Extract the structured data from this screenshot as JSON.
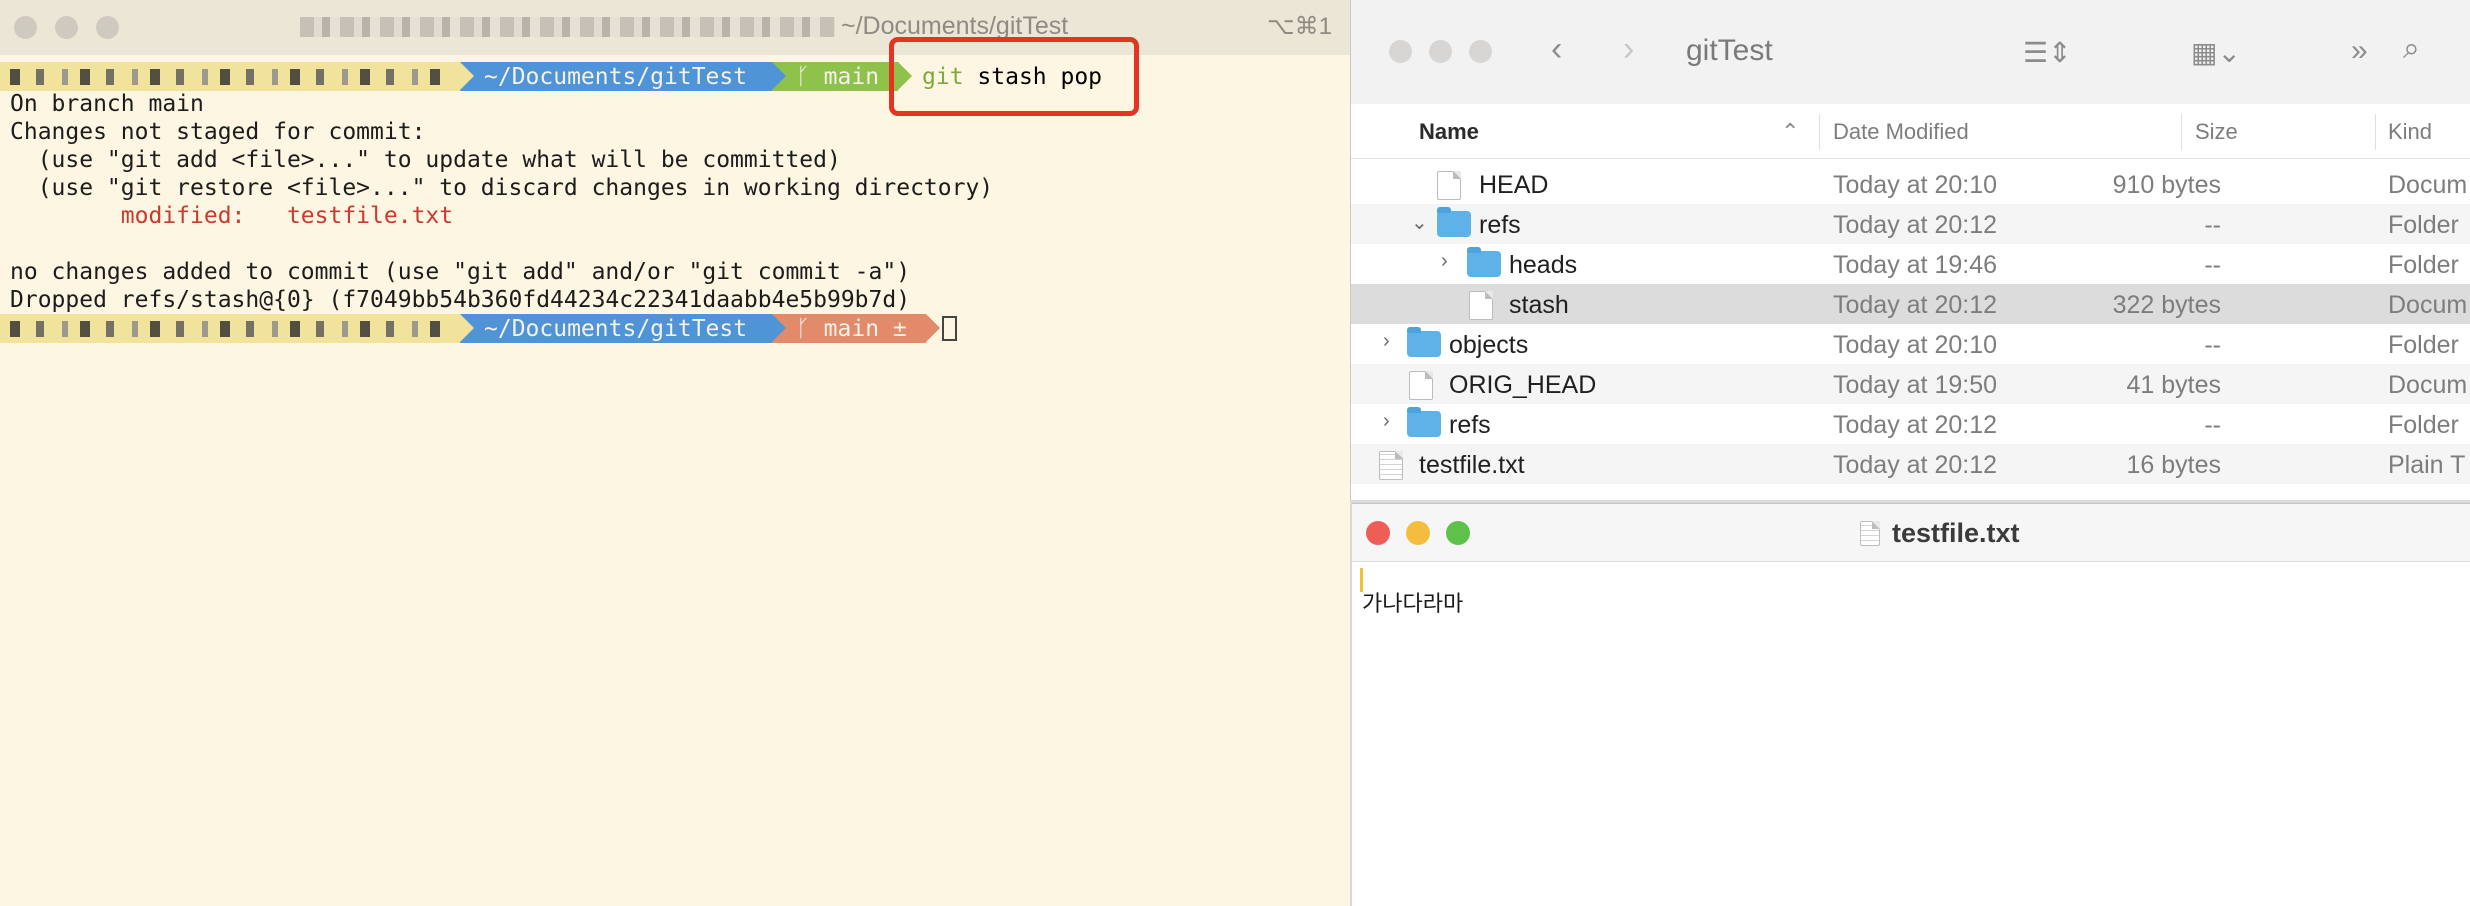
{
  "terminal": {
    "title": "~/Documents/gitTest",
    "shortcut": "⌥⌘1",
    "prompt1": {
      "dir": "~/Documents/gitTest",
      "branch": "main",
      "command_git": "git",
      "command_rest": "stash pop"
    },
    "lines": [
      "On branch main",
      "Changes not staged for commit:",
      "  (use \"git add <file>...\" to update what will be committed)",
      "  (use \"git restore <file>...\" to discard changes in working directory)",
      "        modified:   testfile.txt",
      "",
      "no changes added to commit (use \"git add\" and/or \"git commit -a\")",
      "Dropped refs/stash@{0} (f7049bb54b360fd44234c22341daabb4e5b99b7d)"
    ],
    "prompt2": {
      "dir": "~/Documents/gitTest",
      "branch": "main ±"
    },
    "colors": {
      "background": "#fdf6e3",
      "dir_segment": "#4f94d6",
      "git_clean": "#8ec24a",
      "git_dirty": "#e38a6a",
      "highlight": "#e53324"
    }
  },
  "finder": {
    "title": "gitTest",
    "columns": {
      "name": "Name",
      "date": "Date Modified",
      "size": "Size",
      "kind": "Kind"
    },
    "rows": [
      {
        "name": "HEAD",
        "date": "Today at 20:10",
        "size": "910 bytes",
        "kind": "Docum"
      },
      {
        "name": "refs",
        "date": "Today at 20:12",
        "size": "--",
        "kind": "Folder"
      },
      {
        "name": "heads",
        "date": "Today at 19:46",
        "size": "--",
        "kind": "Folder"
      },
      {
        "name": "stash",
        "date": "Today at 20:12",
        "size": "322 bytes",
        "kind": "Docum"
      },
      {
        "name": "objects",
        "date": "Today at 20:10",
        "size": "--",
        "kind": "Folder"
      },
      {
        "name": "ORIG_HEAD",
        "date": "Today at 19:50",
        "size": "41 bytes",
        "kind": "Docum"
      },
      {
        "name": "refs",
        "date": "Today at 20:12",
        "size": "--",
        "kind": "Folder"
      },
      {
        "name": "testfile.txt",
        "date": "Today at 20:12",
        "size": "16 bytes",
        "kind": "Plain T"
      }
    ]
  },
  "textedit": {
    "title": "testfile.txt",
    "content": "가나다라마",
    "colors": {
      "close": "#ee5e56",
      "minimize": "#f5bd3e",
      "zoom": "#5ec24a"
    }
  }
}
